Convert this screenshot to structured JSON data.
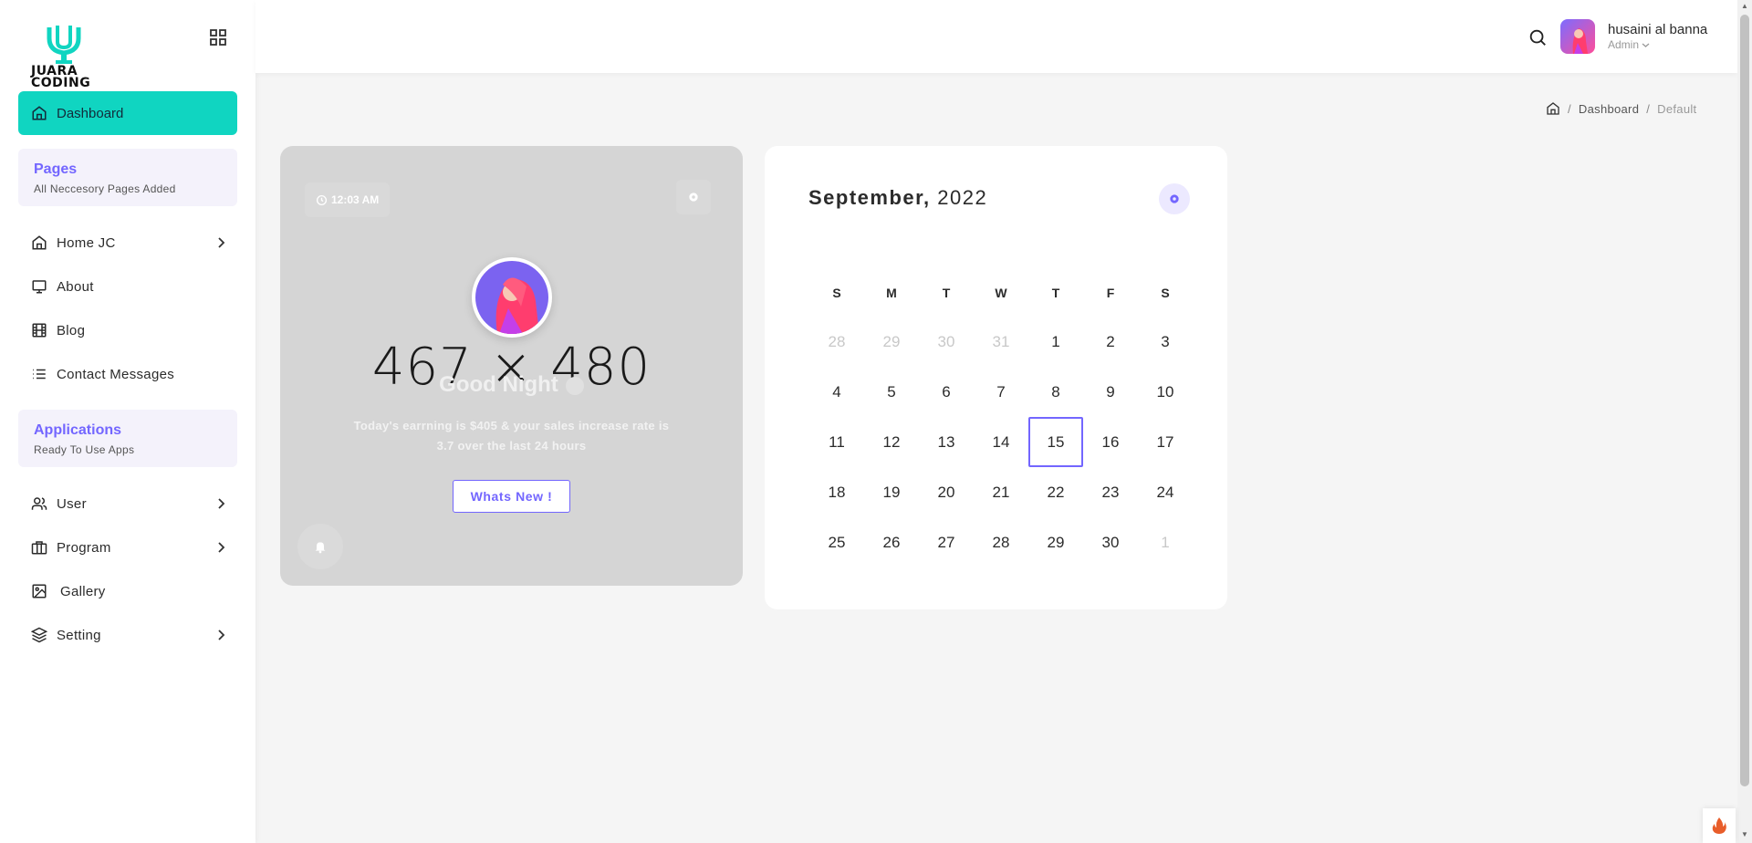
{
  "brand": {
    "logo_text_line1": "JUARA",
    "logo_text_line2": "CODING",
    "accent": "#10d5c1",
    "primary": "#7366ff"
  },
  "sidebar": {
    "dashboard_label": "Dashboard",
    "sections": [
      {
        "title": "Pages",
        "subtitle": "All Neccesory Pages Added"
      },
      {
        "title": "Applications",
        "subtitle": "Ready To Use Apps"
      }
    ],
    "pages_items": [
      {
        "label": "Home JC",
        "icon": "home-icon",
        "has_submenu": true
      },
      {
        "label": "About",
        "icon": "monitor-icon",
        "has_submenu": false
      },
      {
        "label": "Blog",
        "icon": "film-icon",
        "has_submenu": false
      },
      {
        "label": "Contact Messages",
        "icon": "list-icon",
        "has_submenu": false
      }
    ],
    "app_items": [
      {
        "label": "User",
        "icon": "users-icon",
        "has_submenu": true
      },
      {
        "label": "Program",
        "icon": "briefcase-icon",
        "has_submenu": true
      },
      {
        "label": "Gallery",
        "icon": "image-icon",
        "has_submenu": false
      },
      {
        "label": "Setting",
        "icon": "layers-icon",
        "has_submenu": true
      }
    ]
  },
  "header": {
    "user_name": "husaini al banna",
    "user_role": "Admin"
  },
  "breadcrumb": {
    "section": "Dashboard",
    "current": "Default",
    "separator": "/"
  },
  "greeting": {
    "time": "12:03 AM",
    "placeholder": "467 × 480",
    "title": "Good Night",
    "text": "Today's earrning is $405 & your sales increase rate is 3.7 over the last 24 hours",
    "button": "Whats New !"
  },
  "calendar": {
    "month": "September,",
    "year": "2022",
    "weekdays": [
      "S",
      "M",
      "T",
      "W",
      "T",
      "F",
      "S"
    ],
    "days": [
      {
        "d": "28",
        "muted": true
      },
      {
        "d": "29",
        "muted": true
      },
      {
        "d": "30",
        "muted": true
      },
      {
        "d": "31",
        "muted": true
      },
      {
        "d": "1"
      },
      {
        "d": "2"
      },
      {
        "d": "3"
      },
      {
        "d": "4"
      },
      {
        "d": "5"
      },
      {
        "d": "6"
      },
      {
        "d": "7"
      },
      {
        "d": "8"
      },
      {
        "d": "9"
      },
      {
        "d": "10"
      },
      {
        "d": "11"
      },
      {
        "d": "12"
      },
      {
        "d": "13"
      },
      {
        "d": "14"
      },
      {
        "d": "15",
        "today": true
      },
      {
        "d": "16"
      },
      {
        "d": "17"
      },
      {
        "d": "18"
      },
      {
        "d": "19"
      },
      {
        "d": "20"
      },
      {
        "d": "21"
      },
      {
        "d": "22"
      },
      {
        "d": "23"
      },
      {
        "d": "24"
      },
      {
        "d": "25"
      },
      {
        "d": "26"
      },
      {
        "d": "27"
      },
      {
        "d": "28"
      },
      {
        "d": "29"
      },
      {
        "d": "30"
      },
      {
        "d": "1",
        "muted": true
      }
    ]
  }
}
